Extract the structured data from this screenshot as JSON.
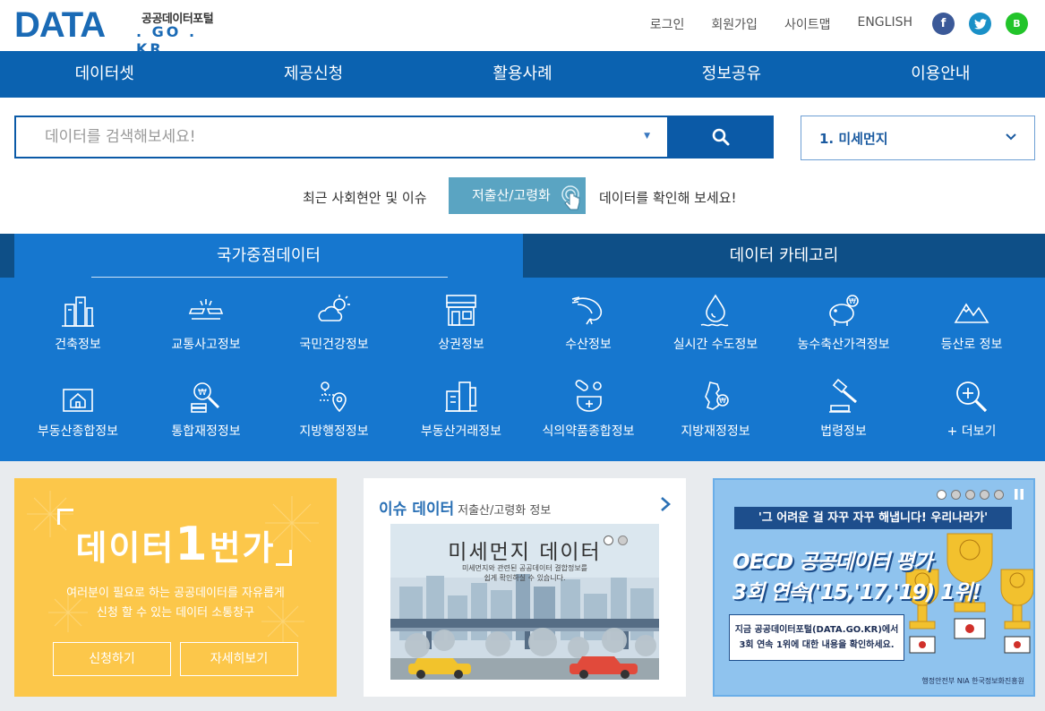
{
  "header": {
    "logo_main": "DATA",
    "logo_kr": "공공데이터포털",
    "logo_domain": ". GO . KR",
    "links": [
      "로그인",
      "회원가입",
      "사이트맵",
      "ENGLISH"
    ],
    "social": [
      "f",
      "t",
      "B"
    ]
  },
  "nav": [
    "데이터셋",
    "제공신청",
    "활용사례",
    "정보공유",
    "이용안내"
  ],
  "search": {
    "placeholder": "데이터를 검색해보세요!",
    "rank_selected": "1. 미세먼지"
  },
  "issue": {
    "pre": "최근 사회현안 및 이슈",
    "tag": "저출산/고령화",
    "post": "데이터를 확인해 보세요!"
  },
  "tabs": {
    "active": "국가중점데이터",
    "other": "데이터 카테고리"
  },
  "categories": [
    {
      "label": "건축정보",
      "icon": "building-icon"
    },
    {
      "label": "교통사고정보",
      "icon": "car-crash-icon"
    },
    {
      "label": "국민건강정보",
      "icon": "weather-cloud-icon"
    },
    {
      "label": "상권정보",
      "icon": "storefront-icon"
    },
    {
      "label": "수산정보",
      "icon": "shrimp-icon"
    },
    {
      "label": "실시간 수도정보",
      "icon": "water-drop-icon"
    },
    {
      "label": "농수축산가격정보",
      "icon": "piggy-bank-icon"
    },
    {
      "label": "등산로 정보",
      "icon": "mountain-icon"
    },
    {
      "label": "부동산종합정보",
      "icon": "house-icon"
    },
    {
      "label": "통합재정정보",
      "icon": "money-search-icon"
    },
    {
      "label": "지방행정정보",
      "icon": "location-pin-icon"
    },
    {
      "label": "부동산거래정보",
      "icon": "real-estate-icon"
    },
    {
      "label": "식의약품종합정보",
      "icon": "medicine-icon"
    },
    {
      "label": "지방재정정보",
      "icon": "korea-map-icon"
    },
    {
      "label": "법령정보",
      "icon": "gavel-icon"
    },
    {
      "label": "+ 더보기",
      "icon": "zoom-plus-icon"
    }
  ],
  "card_request": {
    "title_a": "데이터",
    "title_b": "1",
    "title_c": "번가",
    "desc_line1": "여러분이 필요로 하는 공공데이터를 자유롭게",
    "desc_line2": "신청 할 수 있는 데이터 소통창구",
    "btn_apply": "신청하기",
    "btn_more": "자세히보기"
  },
  "card_issue": {
    "title": "이슈 데이터",
    "subtitle": "저출산/고령화 정보",
    "img_title": "미세먼지 데이터",
    "img_desc_line1": "미세먼지와 관련된 공공데이터 결합정보를",
    "img_desc_line2": "쉽게 확인하실 수 있습니다."
  },
  "card_oecd": {
    "quote": "'그 어려운 걸 자꾸 자꾸 해냅니다! 우리나라가'",
    "big_line1": "OECD 공공데이터 평가",
    "big_line2": "3회 연속('15,'17,'19) 1위!",
    "note_line1": "지금 공공데이터포털(DATA.GO.KR)에서",
    "note_line2": "3회 연속 1위에 대한 내용을 확인하세요.",
    "foot": "행정안전부  NIA 한국정보화진흥원"
  },
  "colors": {
    "brand": "#0b62b0",
    "band": "#1677cf",
    "tab_dark": "#0e4f87",
    "card_yellow": "#fcc74a"
  }
}
